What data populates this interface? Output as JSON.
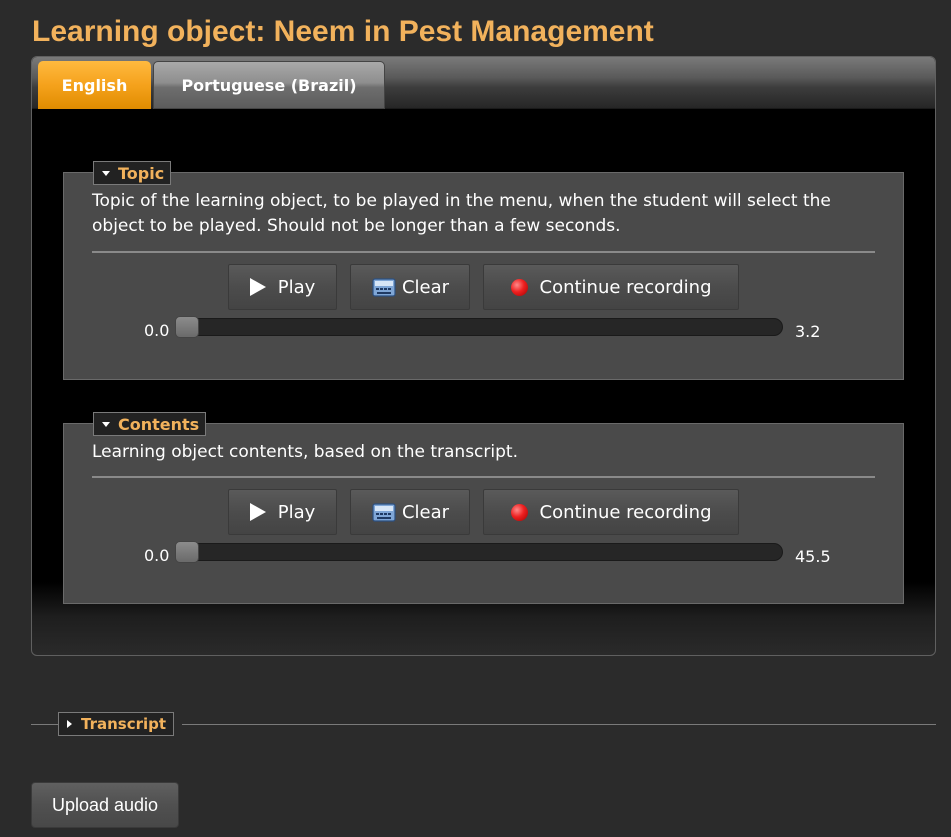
{
  "page_title": "Learning object: Neem in Pest Management",
  "tabs": [
    {
      "label": "English",
      "active": true
    },
    {
      "label": "Portuguese (Brazil)",
      "active": false
    }
  ],
  "sections": [
    {
      "title": "Topic",
      "description": "Topic of the learning object, to be played in the menu, when the student will select the object to be played. Should not be longer than a few seconds.",
      "play_label": "Play",
      "clear_label": "Clear",
      "record_label": "Continue recording",
      "start_time": "0.0",
      "end_time": "3.2"
    },
    {
      "title": "Contents",
      "description": "Learning object contents, based on the transcript.",
      "play_label": "Play",
      "clear_label": "Clear",
      "record_label": "Continue recording",
      "start_time": "0.0",
      "end_time": "45.5"
    }
  ],
  "transcript": {
    "title": "Transcript",
    "expanded": false
  },
  "upload_label": "Upload audio",
  "colors": {
    "accent_orange": "#f5a21c",
    "title_gold": "#f2b25c",
    "background": "#2b2b2b",
    "record_red": "#ee2020"
  },
  "icons": {
    "play": "play-icon",
    "clear": "clear-icon",
    "record": "record-icon",
    "expanded": "caret-down-icon",
    "collapsed": "caret-right-icon"
  }
}
